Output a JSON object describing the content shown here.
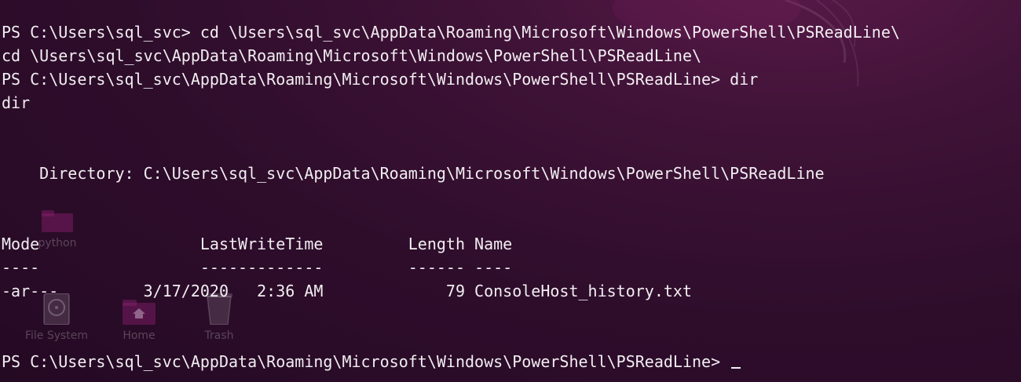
{
  "desktop_icons": {
    "python": "python",
    "file_system": "File System",
    "home": "Home",
    "trash": "Trash"
  },
  "terminal": {
    "lines": [
      "PS C:\\Users\\sql_svc> cd \\Users\\sql_svc\\AppData\\Roaming\\Microsoft\\Windows\\PowerShell\\PSReadLine\\",
      "cd \\Users\\sql_svc\\AppData\\Roaming\\Microsoft\\Windows\\PowerShell\\PSReadLine\\",
      "PS C:\\Users\\sql_svc\\AppData\\Roaming\\Microsoft\\Windows\\PowerShell\\PSReadLine> dir",
      "dir",
      "    Directory: C:\\Users\\sql_svc\\AppData\\Roaming\\Microsoft\\Windows\\PowerShell\\PSReadLine",
      "Mode                 LastWriteTime         Length Name",
      "----                 -------------         ------ ----",
      "-ar---         3/17/2020   2:36 AM             79 ConsoleHost_history.txt",
      "PS C:\\Users\\sql_svc\\AppData\\Roaming\\Microsoft\\Windows\\PowerShell\\PSReadLine> "
    ]
  },
  "colors": {
    "background": "#2e0d2b",
    "text": "#f2eef2"
  }
}
